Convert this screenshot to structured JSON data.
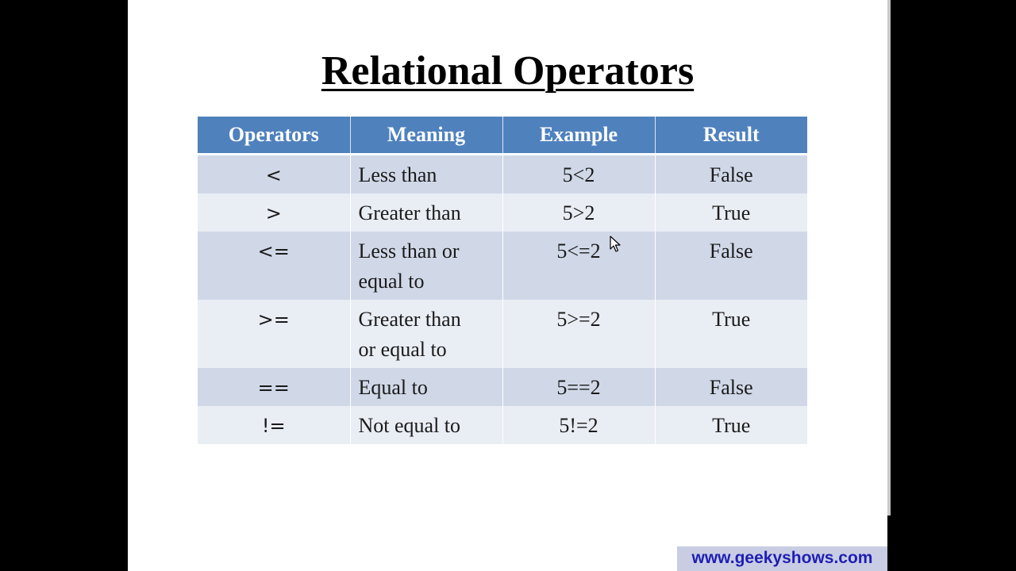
{
  "slide": {
    "title": "Relational Operators",
    "table": {
      "headers": [
        "Operators",
        "Meaning",
        "Example",
        "Result"
      ],
      "rows": [
        {
          "operator": "<",
          "meaning_line1": "Less than",
          "meaning_line2": "",
          "example": "5<2",
          "result": "False"
        },
        {
          "operator": ">",
          "meaning_line1": "Greater than",
          "meaning_line2": "",
          "example": "5>2",
          "result": "True"
        },
        {
          "operator": "<=",
          "meaning_line1": "Less than or",
          "meaning_line2": "equal to",
          "example": "5<=2",
          "result": "False"
        },
        {
          "operator": ">=",
          "meaning_line1": "Greater than",
          "meaning_line2": "or equal to",
          "example": "5>=2",
          "result": "True"
        },
        {
          "operator": "==",
          "meaning_line1": "Equal to",
          "meaning_line2": "",
          "example": "5==2",
          "result": "False"
        },
        {
          "operator": "!=",
          "meaning_line1": "Not equal to",
          "meaning_line2": "",
          "example": "5!=2",
          "result": "True"
        }
      ]
    }
  },
  "watermark": {
    "text": "www.geekyshows.com"
  },
  "colors": {
    "header_bg": "#4f81bd",
    "row_odd_bg": "#d0d8e8",
    "row_even_bg": "#e9edf4",
    "watermark_text": "#1e1eb4"
  },
  "icons": {
    "cursor": "mouse-pointer-icon"
  }
}
